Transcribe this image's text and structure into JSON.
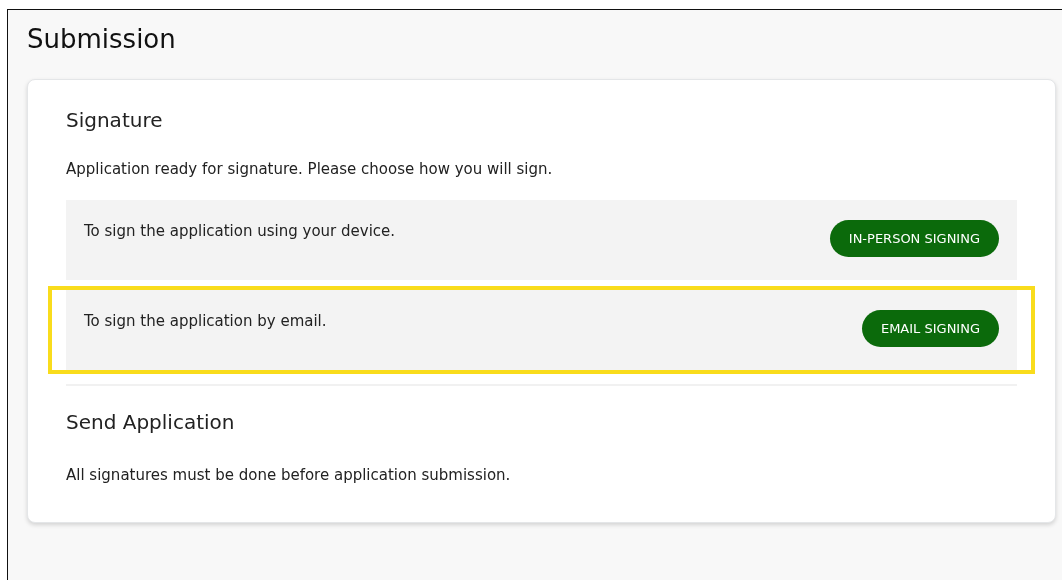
{
  "page_title": "Submission",
  "signature": {
    "heading": "Signature",
    "intro": "Application ready for signature. Please choose how you will sign.",
    "options": [
      {
        "text": "To sign the application using your device.",
        "button": "IN-PERSON SIGNING",
        "highlighted": false
      },
      {
        "text": "To sign the application by email.",
        "button": "EMAIL SIGNING",
        "highlighted": true
      }
    ]
  },
  "send": {
    "heading": "Send Application",
    "note": "All signatures must be done before application submission."
  }
}
